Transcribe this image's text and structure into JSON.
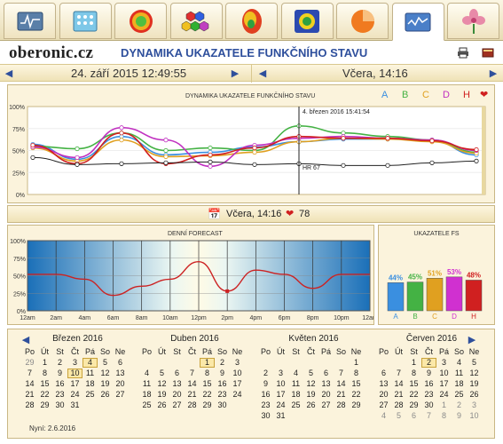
{
  "tabs": [
    {
      "icon": "monitor-wave-icon",
      "active": false
    },
    {
      "icon": "grid-chart-icon",
      "active": false
    },
    {
      "icon": "color-circle-icon",
      "active": false
    },
    {
      "icon": "hexagons-icon",
      "active": false
    },
    {
      "icon": "heatmap-icon",
      "active": false
    },
    {
      "icon": "organ-scan-icon",
      "active": false
    },
    {
      "icon": "pie-chart-icon",
      "active": false
    },
    {
      "icon": "line-monitor-icon",
      "active": true
    },
    {
      "icon": "flower-icon",
      "active": false
    }
  ],
  "header": {
    "logo": "oberonic.cz",
    "title": "DYNAMIKA UKAZATELE FUNKČNÍHO STAVU"
  },
  "nav": {
    "left_date": "24. září 2015 12:49:55",
    "right_date": "Včera, 14:16"
  },
  "chart_data": [
    {
      "type": "line",
      "title": "DYNAMIKA UKAZATELE FUNKČNÍHO STAVU",
      "yticks": [
        "100%",
        "75%",
        "50%",
        "25%",
        "0%"
      ],
      "ylim": [
        0,
        100
      ],
      "legend": [
        "A",
        "B",
        "C",
        "D",
        "H"
      ],
      "legend_colors": [
        "#3a8fe0",
        "#44b244",
        "#e0a020",
        "#c030c0",
        "#d02020"
      ],
      "heart_color": "#d02020",
      "cursor_label": "4. březen 2016 15:41:54",
      "hr_label": "HR 67",
      "series": [
        {
          "name": "A",
          "color": "#3a8fe0",
          "values": [
            57,
            40,
            66,
            45,
            48,
            54,
            60,
            63,
            63,
            61,
            45
          ]
        },
        {
          "name": "B",
          "color": "#44b244",
          "values": [
            55,
            52,
            70,
            50,
            53,
            50,
            78,
            70,
            66,
            62,
            48
          ]
        },
        {
          "name": "C",
          "color": "#e0a020",
          "values": [
            53,
            38,
            62,
            43,
            44,
            48,
            60,
            64,
            63,
            60,
            47
          ]
        },
        {
          "name": "D",
          "color": "#c030c0",
          "values": [
            54,
            42,
            76,
            62,
            32,
            56,
            64,
            66,
            64,
            62,
            50
          ]
        },
        {
          "name": "H",
          "color": "#d02020",
          "values": [
            56,
            35,
            70,
            35,
            45,
            53,
            66,
            64,
            64,
            61,
            51
          ]
        },
        {
          "name": "HR",
          "color": "#222222",
          "values": [
            42,
            34,
            35,
            36,
            37,
            34,
            35,
            33,
            33,
            36,
            38
          ]
        }
      ]
    },
    {
      "type": "line",
      "title": "DENNÍ FORECAST",
      "yticks": [
        "100%",
        "75%",
        "50%",
        "25%",
        "0%"
      ],
      "ylim": [
        0,
        100
      ],
      "xticks": [
        "12am",
        "2am",
        "4am",
        "6am",
        "8am",
        "10am",
        "12pm",
        "2pm",
        "4pm",
        "6pm",
        "8pm",
        "10pm",
        "12am"
      ],
      "series": [
        {
          "name": "forecast",
          "color": "#c22",
          "values": [
            52,
            52,
            45,
            22,
            35,
            45,
            70,
            28,
            58,
            52,
            32,
            52,
            52
          ]
        }
      ]
    },
    {
      "type": "bar",
      "title": "UKAZATELE FS",
      "categories": [
        "A",
        "B",
        "C",
        "D",
        "H"
      ],
      "values": [
        44,
        45,
        51,
        53,
        48
      ],
      "labels": [
        "44%",
        "45%",
        "51%",
        "53%",
        "48%"
      ],
      "colors": [
        "#3a8fe0",
        "#44b244",
        "#e0a020",
        "#d030d0",
        "#d02020"
      ],
      "ylim": [
        0,
        100
      ]
    }
  ],
  "subbar": {
    "text": "Včera, 14:16",
    "hr": "78"
  },
  "calendar": {
    "weekdays": [
      "Po",
      "Út",
      "St",
      "Čt",
      "Pá",
      "So",
      "Ne"
    ],
    "months": [
      {
        "name": "Březen 2016",
        "days": [
          "29",
          "1",
          "2",
          "3",
          "4",
          "5",
          "6",
          "7",
          "8",
          "9",
          "10",
          "11",
          "12",
          "13",
          "14",
          "15",
          "16",
          "17",
          "18",
          "19",
          "20",
          "21",
          "22",
          "23",
          "24",
          "25",
          "26",
          "27",
          "28",
          "29",
          "30",
          "31"
        ],
        "lead": 1,
        "sel": [
          "4",
          "10"
        ]
      },
      {
        "name": "Duben 2016",
        "days": [
          "1",
          "2",
          "3",
          "4",
          "5",
          "6",
          "7",
          "8",
          "9",
          "10",
          "11",
          "12",
          "13",
          "14",
          "15",
          "16",
          "17",
          "18",
          "19",
          "20",
          "21",
          "22",
          "23",
          "24",
          "25",
          "26",
          "27",
          "28",
          "29",
          "30"
        ],
        "lead": 4,
        "sel": [
          "1"
        ]
      },
      {
        "name": "Květen 2016",
        "days": [
          "1",
          "2",
          "3",
          "4",
          "5",
          "6",
          "7",
          "8",
          "9",
          "10",
          "11",
          "12",
          "13",
          "14",
          "15",
          "16",
          "17",
          "18",
          "19",
          "20",
          "21",
          "22",
          "23",
          "24",
          "25",
          "26",
          "27",
          "28",
          "29",
          "30",
          "31"
        ],
        "lead": 6,
        "sel": []
      },
      {
        "name": "Červen 2016",
        "days": [
          "1",
          "2",
          "3",
          "4",
          "5",
          "6",
          "7",
          "8",
          "9",
          "10",
          "11",
          "12",
          "13",
          "14",
          "15",
          "16",
          "17",
          "18",
          "19",
          "20",
          "21",
          "22",
          "23",
          "24",
          "25",
          "26",
          "27",
          "28",
          "29",
          "30",
          "1",
          "2",
          "3",
          "4",
          "5",
          "6",
          "7",
          "8",
          "9",
          "10"
        ],
        "lead": 2,
        "sel": [
          "2"
        ],
        "tailstart": 30
      }
    ],
    "now": "Nyní: 2.6.2016"
  }
}
